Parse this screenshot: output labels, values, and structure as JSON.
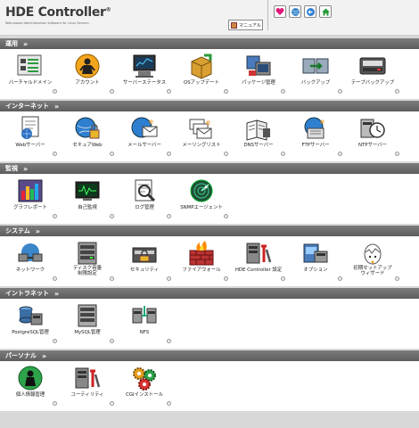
{
  "header": {
    "logo_title": "HDE Controller",
    "logo_tm": "®",
    "logo_subtitle": "Web-based Administration Software for Linux Servers",
    "manual_label": "マニュアル",
    "toolbar_icons": [
      "heart-icon",
      "globe-icon",
      "back-arrow-icon",
      "home-icon"
    ]
  },
  "sections": [
    {
      "title": "運用",
      "items": [
        {
          "label": "バーチャルドメイン",
          "icon": "virtual-domain-icon"
        },
        {
          "label": "アカウント",
          "icon": "account-icon"
        },
        {
          "label": "サーバーステータス",
          "icon": "server-status-icon"
        },
        {
          "label": "OSアップデート",
          "icon": "os-update-icon"
        },
        {
          "label": "パッケージ管理",
          "icon": "package-icon"
        },
        {
          "label": "バックアップ",
          "icon": "backup-icon"
        },
        {
          "label": "テープバックアップ",
          "icon": "tape-backup-icon"
        }
      ]
    },
    {
      "title": "インターネット",
      "items": [
        {
          "label": "Webサーバー",
          "icon": "web-server-icon"
        },
        {
          "label": "セキュアWeb",
          "icon": "secure-web-icon"
        },
        {
          "label": "メールサーバー",
          "icon": "mail-server-icon"
        },
        {
          "label": "メーリングリスト",
          "icon": "mailing-list-icon"
        },
        {
          "label": "DNSサーバー",
          "icon": "dns-server-icon"
        },
        {
          "label": "FTPサーバー",
          "icon": "ftp-server-icon"
        },
        {
          "label": "NTPサーバー",
          "icon": "ntp-server-icon"
        }
      ]
    },
    {
      "title": "監視",
      "items": [
        {
          "label": "グラフレポート",
          "icon": "graph-report-icon"
        },
        {
          "label": "自己監視",
          "icon": "self-monitor-icon"
        },
        {
          "label": "ログ管理",
          "icon": "log-icon"
        },
        {
          "label": "SNMPエージェント",
          "icon": "snmp-agent-icon"
        }
      ]
    },
    {
      "title": "システム",
      "items": [
        {
          "label": "ネットワーク",
          "icon": "network-icon"
        },
        {
          "label": "ディスク容量\n制限設定",
          "icon": "disk-quota-icon"
        },
        {
          "label": "セキュリティ",
          "icon": "security-icon"
        },
        {
          "label": "ファイアウォール",
          "icon": "firewall-icon"
        },
        {
          "label": "HDE Controller 設定",
          "icon": "controller-settings-icon"
        },
        {
          "label": "オプション",
          "icon": "options-icon"
        },
        {
          "label": "初期セットアップ\nウィザード",
          "icon": "setup-wizard-icon"
        }
      ]
    },
    {
      "title": "イントラネット",
      "items": [
        {
          "label": "PostgreSQL管理",
          "icon": "postgresql-icon"
        },
        {
          "label": "MySQL管理",
          "icon": "mysql-icon"
        },
        {
          "label": "NFS",
          "icon": "nfs-icon"
        }
      ]
    },
    {
      "title": "パーソナル",
      "items": [
        {
          "label": "個人情報管理",
          "icon": "personal-info-icon"
        },
        {
          "label": "ユーティリティ",
          "icon": "utility-icon"
        },
        {
          "label": "CGIインストール",
          "icon": "cgi-install-icon"
        }
      ]
    }
  ],
  "colors": {
    "section_bar": "#6b6b6b",
    "body_bg": "#ffffff",
    "page_bg": "#d8d8d8"
  }
}
